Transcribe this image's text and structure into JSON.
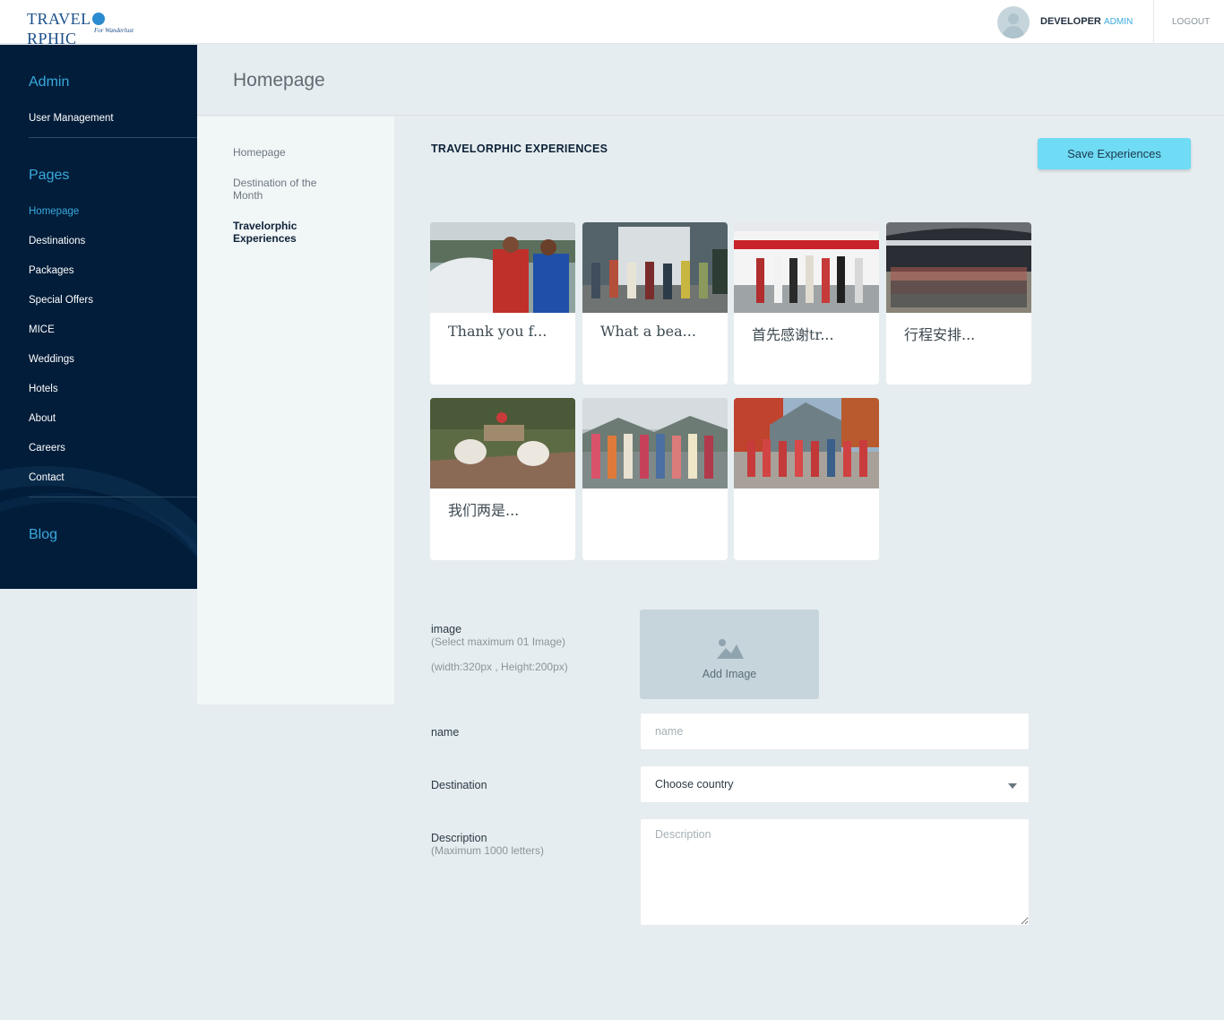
{
  "header": {
    "logo_text_left": "TRAVEL",
    "logo_text_right": "RPHIC",
    "logo_tagline": "For Wanderlust",
    "user_name": "DEVELOPER",
    "user_role": "ADMIN",
    "logout_label": "LOGOUT"
  },
  "sidebar": {
    "admin_heading": "Admin",
    "admin_items": [
      "User Management"
    ],
    "pages_heading": "Pages",
    "pages_items": [
      "Homepage",
      "Destinations",
      "Packages",
      "Special Offers",
      "MICE",
      "Weddings",
      "Hotels",
      "About",
      "Careers",
      "Contact"
    ],
    "active_item": "Homepage",
    "blog_heading": "Blog"
  },
  "page": {
    "title": "Homepage"
  },
  "subnav": {
    "items": [
      "Homepage",
      "Destination of the Month",
      "Travelorphic Experiences"
    ],
    "active_item": "Travelorphic Experiences"
  },
  "experiences": {
    "section_title": "TRAVELORPHIC EXPERIENCES",
    "save_button": "Save Experiences",
    "cards": [
      {
        "caption": "Thank you f..."
      },
      {
        "caption": "What a bea..."
      },
      {
        "caption": "首先感谢tr..."
      },
      {
        "caption": "行程安排..."
      },
      {
        "caption": "我们两是..."
      },
      {
        "caption": ""
      },
      {
        "caption": ""
      }
    ]
  },
  "form": {
    "image_label": "image",
    "image_hint": "(Select maximum 01 Image)",
    "image_size_hint": "(width:320px , Height:200px)",
    "add_image_label": "Add Image",
    "name_label": "name",
    "name_placeholder": "name",
    "destination_label": "Destination",
    "destination_value": "Choose country",
    "description_label": "Description",
    "description_hint": "(Maximum 1000 letters)",
    "description_placeholder": "Description"
  },
  "colors": {
    "sidebar_bg": "#021d3a",
    "accent": "#39a9dd",
    "save_button_bg": "#70dbf4",
    "page_bg": "#e6edf0"
  }
}
